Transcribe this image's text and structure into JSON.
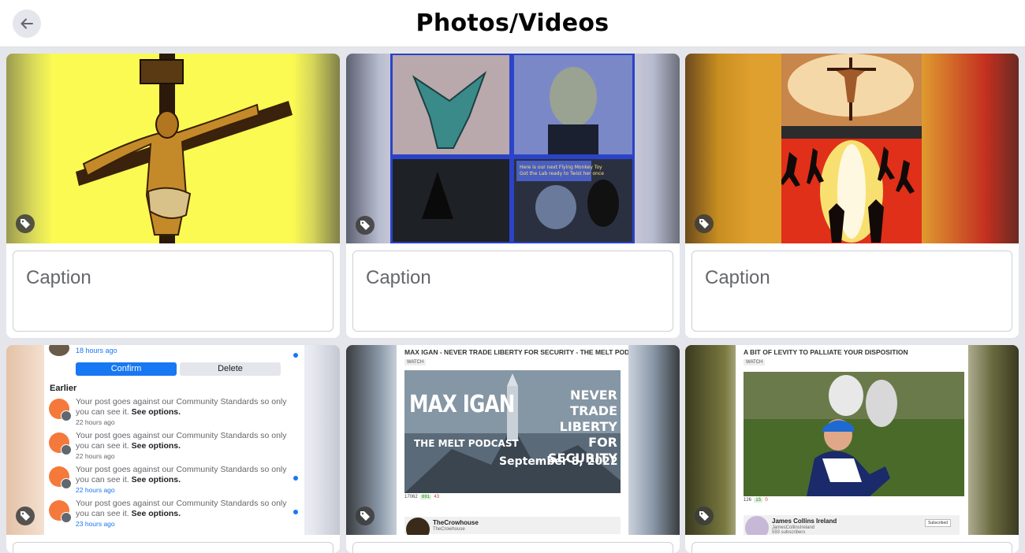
{
  "header": {
    "title": "Photos/Videos",
    "back_icon": "arrow-left-icon"
  },
  "captions": {
    "placeholder": "Caption"
  },
  "colors": {
    "accent": "#1877f2",
    "warning": "#f5793b"
  },
  "notifications": {
    "top_time": "18 hours ago",
    "confirm_label": "Confirm",
    "delete_label": "Delete",
    "section_label": "Earlier",
    "items": [
      {
        "text": "Your post goes against our Community Standards so only you can see it.",
        "link": "See options.",
        "time": "22 hours ago"
      },
      {
        "text": "Your post goes against our Community Standards so only you can see it.",
        "link": "See options.",
        "time": "22 hours ago"
      },
      {
        "text": "Your post goes against our Community Standards so only you can see it.",
        "link": "See options.",
        "time": "22 hours ago"
      },
      {
        "text": "Your post goes against our Community Standards so only you can see it.",
        "link": "See options.",
        "time": "23 hours ago"
      }
    ]
  },
  "video1": {
    "title": "MAX IGAN - NEVER TRADE LIBERTY FOR SECURITY - THE MELT PODCAST",
    "watch": "WATCH",
    "thumb_title": "MAX IGAN",
    "thumb_slogan": "NEVER TRADE LIBERTY FOR SECURITY",
    "thumb_podcast": "THE MELT PODCAST",
    "thumb_date": "September 8, 2022",
    "views": "17062",
    "likes": "691",
    "dislikes": "43",
    "channel": "TheCrowhouse",
    "channel_handle": "TheCrowhouse"
  },
  "video2": {
    "title": "A BIT OF LEVITY TO PALLIATE YOUR DISPOSITION",
    "watch": "WATCH",
    "views": "126",
    "likes": "15",
    "dislikes": "0",
    "channel": "James Collins Ireland",
    "channel_handle": "JamesCollinsIreland",
    "subscribers": "593 subscribers",
    "subscribed_label": "Subscribed"
  }
}
